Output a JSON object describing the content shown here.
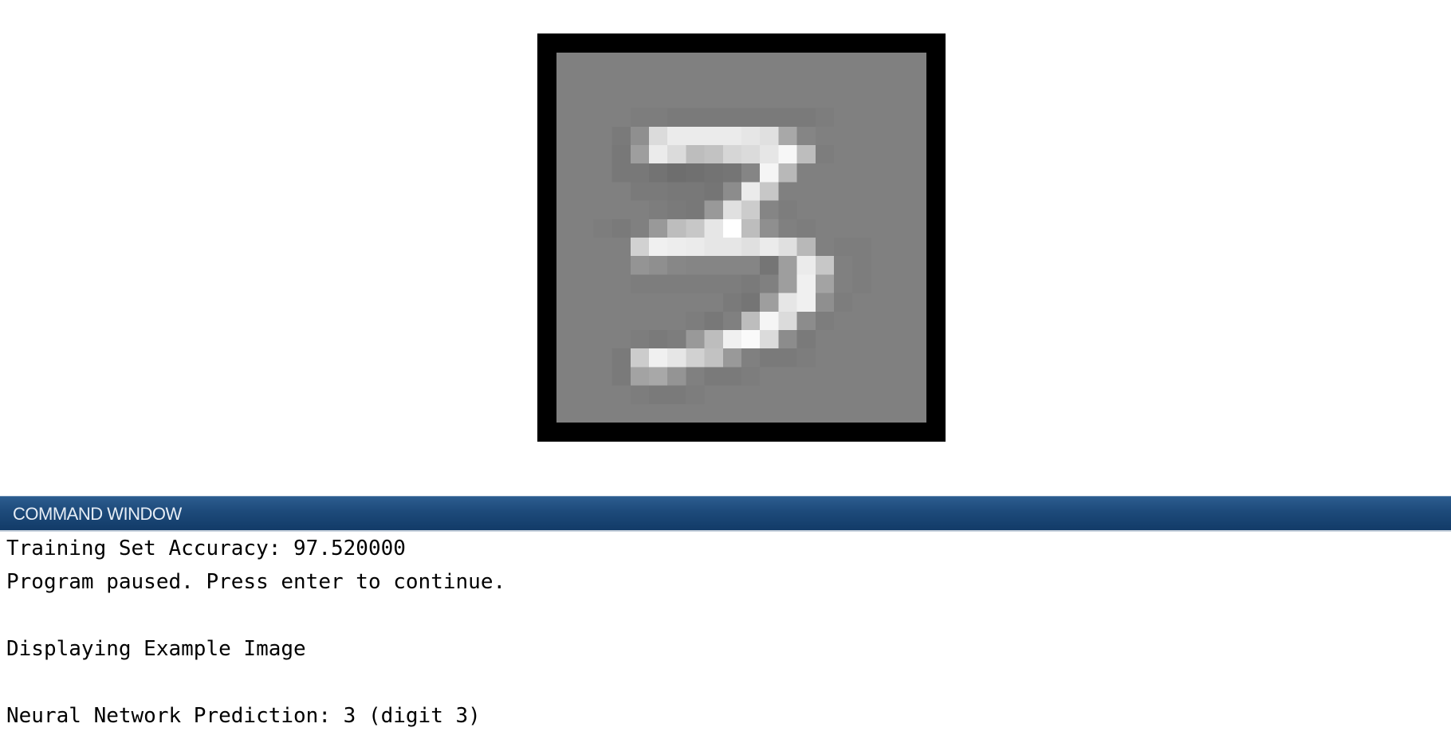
{
  "figure": {
    "image_description_icon": "mnist-digit-image",
    "grid_size": 20,
    "pixels": [
      [
        0.5,
        0.5,
        0.5,
        0.5,
        0.5,
        0.5,
        0.5,
        0.5,
        0.5,
        0.5,
        0.5,
        0.5,
        0.5,
        0.5,
        0.5,
        0.5,
        0.5,
        0.5,
        0.5,
        0.5
      ],
      [
        0.5,
        0.5,
        0.5,
        0.5,
        0.5,
        0.5,
        0.5,
        0.5,
        0.5,
        0.5,
        0.5,
        0.5,
        0.5,
        0.5,
        0.5,
        0.5,
        0.5,
        0.5,
        0.5,
        0.5
      ],
      [
        0.5,
        0.5,
        0.5,
        0.5,
        0.5,
        0.5,
        0.5,
        0.5,
        0.5,
        0.5,
        0.5,
        0.5,
        0.5,
        0.5,
        0.5,
        0.5,
        0.5,
        0.5,
        0.5,
        0.5
      ],
      [
        0.5,
        0.5,
        0.5,
        0.5,
        0.49,
        0.49,
        0.48,
        0.48,
        0.48,
        0.48,
        0.48,
        0.48,
        0.48,
        0.48,
        0.49,
        0.5,
        0.5,
        0.5,
        0.5,
        0.5
      ],
      [
        0.5,
        0.5,
        0.5,
        0.48,
        0.56,
        0.86,
        0.92,
        0.92,
        0.92,
        0.92,
        0.9,
        0.88,
        0.66,
        0.52,
        0.5,
        0.5,
        0.5,
        0.5,
        0.5,
        0.5
      ],
      [
        0.5,
        0.5,
        0.5,
        0.47,
        0.62,
        0.92,
        0.86,
        0.74,
        0.76,
        0.84,
        0.86,
        0.9,
        0.97,
        0.74,
        0.49,
        0.5,
        0.5,
        0.5,
        0.5,
        0.5
      ],
      [
        0.5,
        0.5,
        0.5,
        0.47,
        0.47,
        0.45,
        0.43,
        0.44,
        0.45,
        0.46,
        0.52,
        0.96,
        0.72,
        0.5,
        0.5,
        0.5,
        0.5,
        0.5,
        0.5,
        0.5
      ],
      [
        0.5,
        0.5,
        0.5,
        0.5,
        0.48,
        0.48,
        0.47,
        0.47,
        0.46,
        0.55,
        0.92,
        0.78,
        0.5,
        0.5,
        0.5,
        0.5,
        0.5,
        0.5,
        0.5,
        0.5
      ],
      [
        0.5,
        0.5,
        0.5,
        0.5,
        0.5,
        0.49,
        0.48,
        0.47,
        0.6,
        0.88,
        0.8,
        0.52,
        0.49,
        0.5,
        0.5,
        0.5,
        0.5,
        0.5,
        0.5,
        0.5
      ],
      [
        0.5,
        0.5,
        0.49,
        0.48,
        0.5,
        0.6,
        0.74,
        0.78,
        0.9,
        1.0,
        0.74,
        0.56,
        0.5,
        0.49,
        0.5,
        0.5,
        0.5,
        0.5,
        0.5,
        0.5
      ],
      [
        0.5,
        0.5,
        0.5,
        0.5,
        0.82,
        0.94,
        0.93,
        0.92,
        0.9,
        0.9,
        0.88,
        0.92,
        0.88,
        0.72,
        0.5,
        0.49,
        0.49,
        0.5,
        0.5,
        0.5
      ],
      [
        0.5,
        0.5,
        0.5,
        0.5,
        0.58,
        0.56,
        0.53,
        0.52,
        0.52,
        0.52,
        0.52,
        0.46,
        0.62,
        0.92,
        0.78,
        0.5,
        0.49,
        0.5,
        0.5,
        0.5
      ],
      [
        0.5,
        0.5,
        0.5,
        0.5,
        0.49,
        0.49,
        0.49,
        0.49,
        0.49,
        0.49,
        0.48,
        0.5,
        0.62,
        0.94,
        0.64,
        0.5,
        0.49,
        0.5,
        0.5,
        0.5
      ],
      [
        0.5,
        0.5,
        0.5,
        0.5,
        0.5,
        0.5,
        0.5,
        0.5,
        0.5,
        0.48,
        0.46,
        0.62,
        0.9,
        0.94,
        0.56,
        0.49,
        0.5,
        0.5,
        0.5,
        0.5
      ],
      [
        0.5,
        0.5,
        0.5,
        0.5,
        0.5,
        0.5,
        0.5,
        0.49,
        0.47,
        0.5,
        0.74,
        0.96,
        0.86,
        0.55,
        0.49,
        0.5,
        0.5,
        0.5,
        0.5,
        0.5
      ],
      [
        0.5,
        0.5,
        0.5,
        0.5,
        0.49,
        0.48,
        0.49,
        0.6,
        0.74,
        0.94,
        0.98,
        0.86,
        0.55,
        0.48,
        0.5,
        0.5,
        0.5,
        0.5,
        0.5,
        0.5
      ],
      [
        0.5,
        0.5,
        0.5,
        0.48,
        0.8,
        0.94,
        0.9,
        0.82,
        0.76,
        0.6,
        0.5,
        0.48,
        0.48,
        0.49,
        0.5,
        0.5,
        0.5,
        0.5,
        0.5,
        0.5
      ],
      [
        0.5,
        0.5,
        0.5,
        0.48,
        0.64,
        0.66,
        0.58,
        0.5,
        0.48,
        0.48,
        0.49,
        0.5,
        0.5,
        0.5,
        0.5,
        0.5,
        0.5,
        0.5,
        0.5,
        0.5
      ],
      [
        0.5,
        0.5,
        0.5,
        0.5,
        0.49,
        0.48,
        0.48,
        0.49,
        0.5,
        0.5,
        0.5,
        0.5,
        0.5,
        0.5,
        0.5,
        0.5,
        0.5,
        0.5,
        0.5,
        0.5
      ],
      [
        0.5,
        0.5,
        0.5,
        0.5,
        0.5,
        0.5,
        0.5,
        0.5,
        0.5,
        0.5,
        0.5,
        0.5,
        0.5,
        0.5,
        0.5,
        0.5,
        0.5,
        0.5,
        0.5,
        0.5
      ]
    ]
  },
  "command_window": {
    "title": "COMMAND WINDOW",
    "header_color": "#1d4a7a",
    "lines": [
      "Training Set Accuracy: 97.520000",
      "Program paused. Press enter to continue.",
      "",
      "Displaying Example Image",
      "",
      "Neural Network Prediction: 3 (digit 3)"
    ]
  }
}
